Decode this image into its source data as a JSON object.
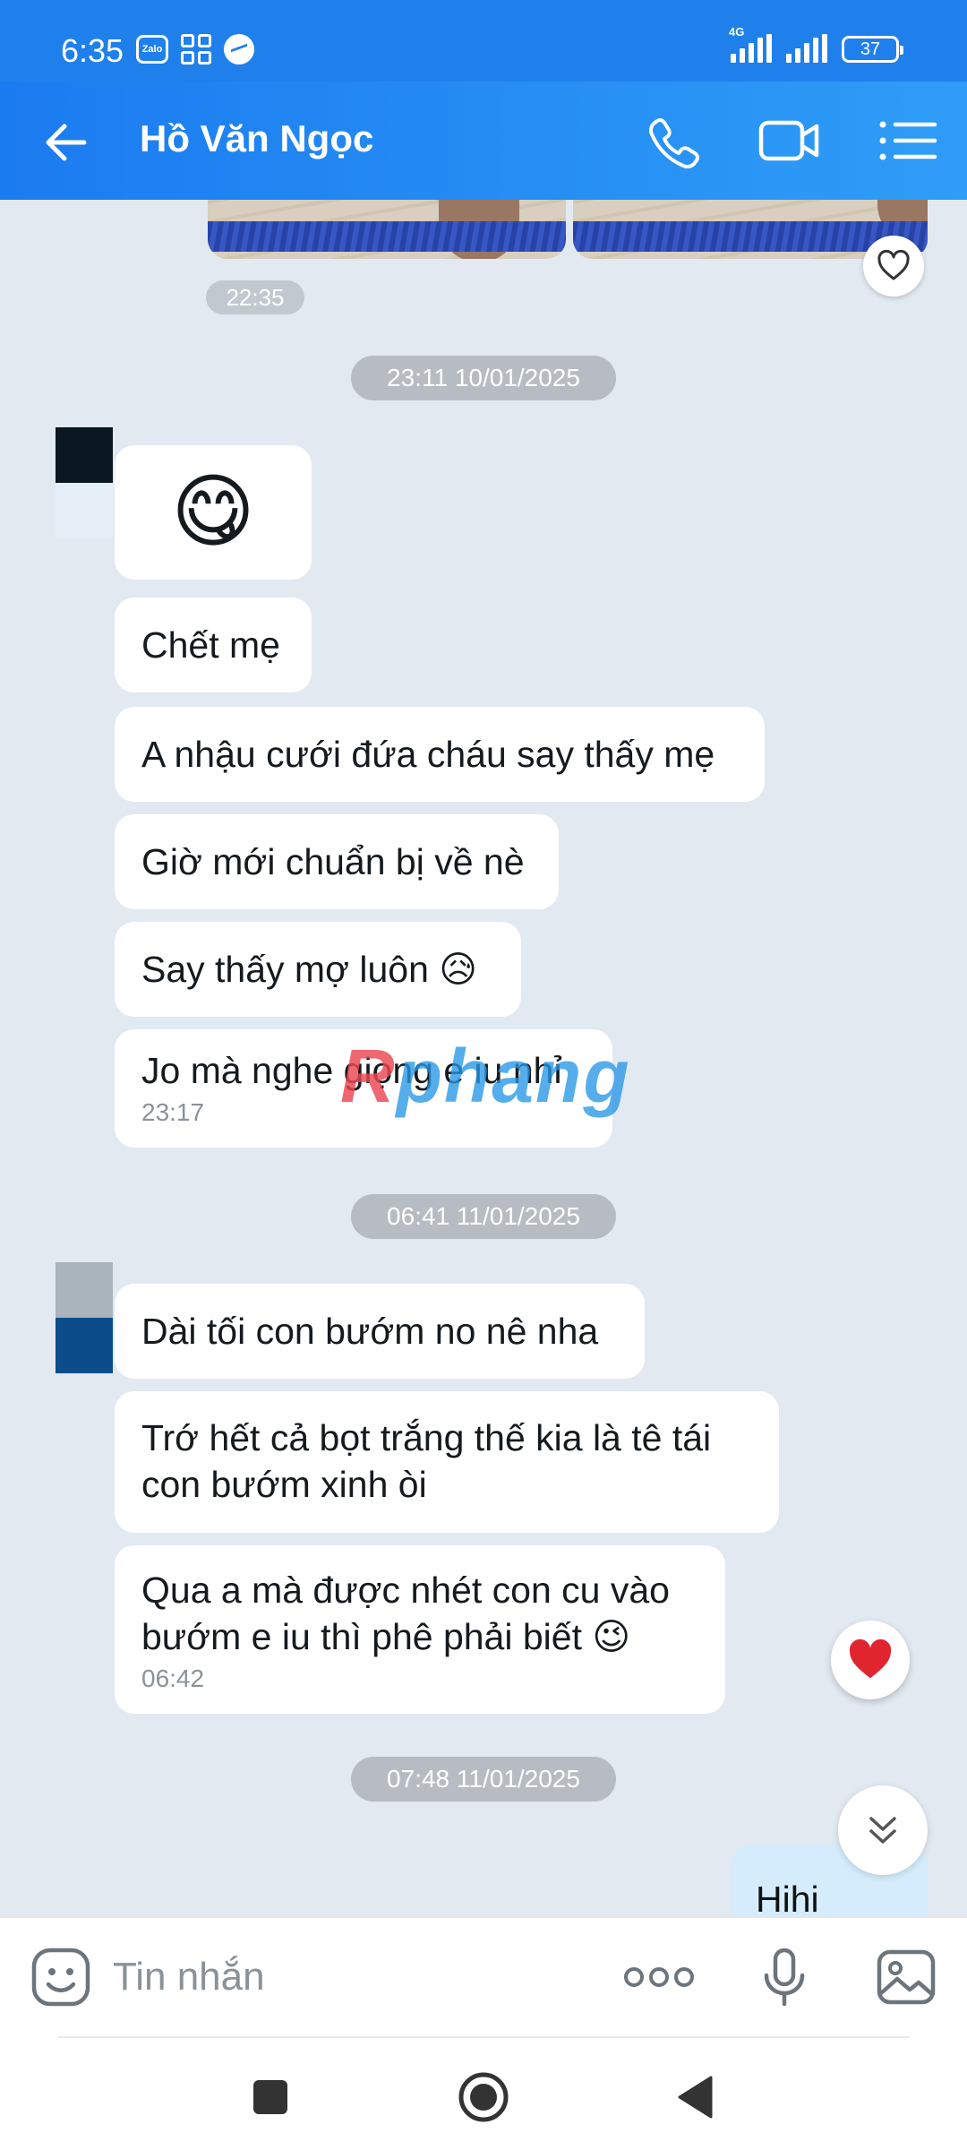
{
  "status_bar": {
    "time": "6:35",
    "network": "4G",
    "battery": "37",
    "zalo_icon": "Zalo"
  },
  "header": {
    "contact_name": "Hồ Văn Ngọc"
  },
  "chat": {
    "first_time": "22:35",
    "date_1": "23:11 10/01/2025",
    "group_1": [
      {
        "text": "😋"
      },
      {
        "text": "Chết mẹ"
      },
      {
        "text": "A nhậu cưới đứa cháu say thấy mẹ"
      },
      {
        "text": "Giờ mới chuẩn bị về nè"
      },
      {
        "text": "Say thấy mợ luôn 😥"
      },
      {
        "text": "Jo mà nghe giọng e iu nhỉ",
        "time": "23:17"
      }
    ],
    "date_2": "06:41 11/01/2025",
    "group_2": [
      {
        "text": "Dài tối con bướm no nê nha"
      },
      {
        "text": "Trớ hết cả bọt trắng thế kia là tê tái con bướm xinh òi"
      },
      {
        "text": "Qua a mà được nhét con cu vào bướm e iu thì phê phải biết 😉",
        "time": "06:42"
      }
    ],
    "date_3": "07:48 11/01/2025",
    "my_message": "Hihi"
  },
  "watermark": {
    "part1": "R",
    "part2": "phang"
  },
  "input": {
    "placeholder": "Tin nhắn"
  },
  "colors": {
    "header": "#1f80ec",
    "background": "#e2e9f1",
    "my_bubble": "#d4ecfb",
    "date_pill": "#b7bcc3"
  }
}
